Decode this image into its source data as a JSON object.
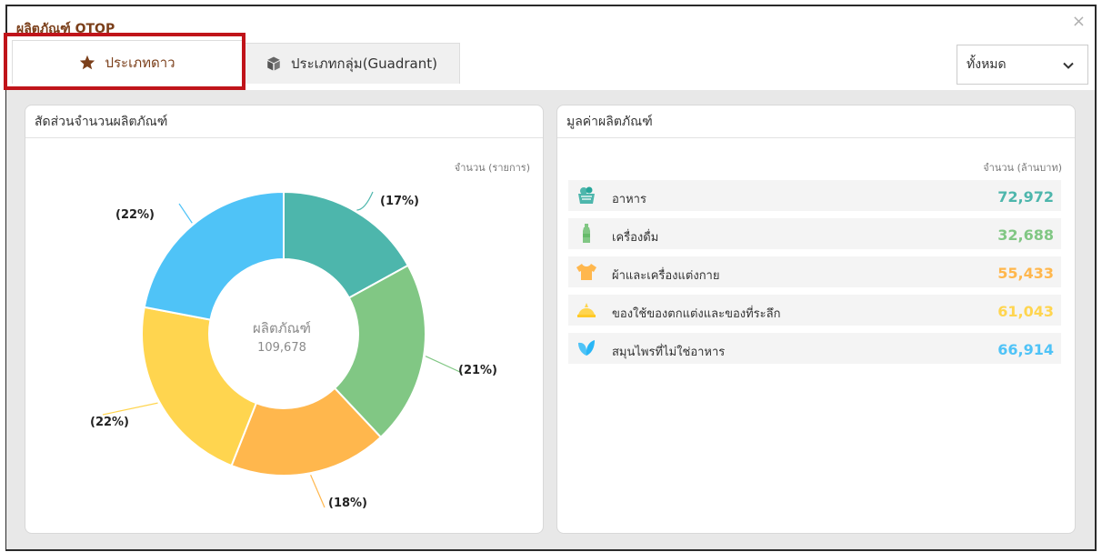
{
  "window": {
    "title": "ผลิตภัณฑ์ OTOP"
  },
  "tabs": [
    {
      "label": "ประเภทดาว",
      "icon": "star-icon",
      "active": true
    },
    {
      "label": "ประเภทกลุ่ม(Guadrant)",
      "icon": "box-icon",
      "active": false
    }
  ],
  "filter": {
    "selected": "ทั้งหมด",
    "options": [
      "ทั้งหมด"
    ]
  },
  "colors": {
    "brand": "#7b3f1a",
    "highlight": "#c0141a",
    "food": "#4db6ac",
    "drink": "#81c784",
    "cloth": "#ffb74d",
    "souvenir": "#ffd54f",
    "herb": "#4fc3f7"
  },
  "left_card": {
    "title": "สัดส่วนจำนวนผลิตภัณฑ์",
    "unit": "จำนวน (รายการ)",
    "center_label": "ผลิตภัณฑ์",
    "center_value": "109,678"
  },
  "right_card": {
    "title": "มูลค่าผลิตภัณฑ์",
    "unit": "จำนวน (ล้านบาท)",
    "rows": [
      {
        "name": "อาหาร",
        "value": "72,972",
        "color": "#4db6ac",
        "icon": "food-basket-icon"
      },
      {
        "name": "เครื่องดื่ม",
        "value": "32,688",
        "color": "#81c784",
        "icon": "bottle-icon"
      },
      {
        "name": "ผ้าและเครื่องแต่งกาย",
        "value": "55,433",
        "color": "#ffb74d",
        "icon": "shirt-icon"
      },
      {
        "name": "ของใช้ของตกแต่งและของที่ระลึก",
        "value": "61,043",
        "color": "#ffd54f",
        "icon": "souvenir-icon"
      },
      {
        "name": "สมุนไพรที่ไม่ใช่อาหาร",
        "value": "66,914",
        "color": "#4fc3f7",
        "icon": "leaf-icon"
      }
    ]
  },
  "chart_data": {
    "type": "pie",
    "title": "สัดส่วนจำนวนผลิตภัณฑ์",
    "unit_label": "จำนวน (รายการ)",
    "slices": [
      {
        "value": 17,
        "label": "(17%)",
        "color": "#4db6ac"
      },
      {
        "value": 21,
        "label": "(21%)",
        "color": "#81c784"
      },
      {
        "value": 18,
        "label": "(18%)",
        "color": "#ffb74d"
      },
      {
        "value": 22,
        "label": "(22%)",
        "color": "#ffd54f"
      },
      {
        "value": 22,
        "label": "(22%)",
        "color": "#4fc3f7"
      }
    ],
    "total": "109,678"
  }
}
